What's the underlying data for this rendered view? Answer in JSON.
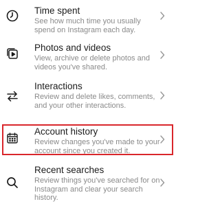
{
  "items": [
    {
      "title": "Time spent",
      "description": "See how much time you usually spend on Instagram each day.",
      "icon": "clock-icon"
    },
    {
      "title": "Photos and videos",
      "description": "View, archive or delete photos and videos you've shared.",
      "icon": "photos-videos-icon"
    },
    {
      "title": "Interactions",
      "description": "Review and delete likes, comments, and your other interactions.",
      "icon": "interactions-arrows-icon"
    },
    {
      "title": "Account history",
      "description": "Review changes you've made to your account since you created it.",
      "icon": "calendar-icon",
      "highlighted": true
    },
    {
      "title": "Recent searches",
      "description": "Review things you've searched for on Instagram and clear your search history.",
      "icon": "search-icon"
    }
  ],
  "colors": {
    "title": "#1b1b1b",
    "description": "#8a8a8a",
    "highlight_border": "#d9262b",
    "chevron": "#9a9a9a"
  }
}
